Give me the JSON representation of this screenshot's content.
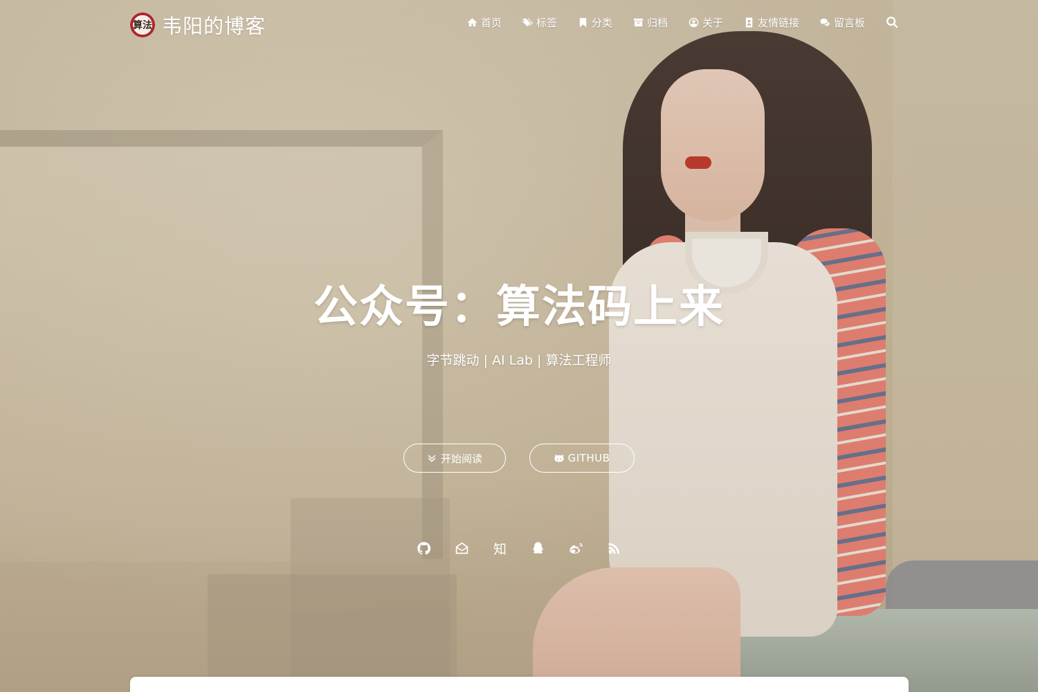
{
  "brand": {
    "logo_text": "算法",
    "title": "韦阳的博客"
  },
  "nav": {
    "items": [
      {
        "label": "首页",
        "icon": "home-icon"
      },
      {
        "label": "标签",
        "icon": "tags-icon"
      },
      {
        "label": "分类",
        "icon": "bookmark-icon"
      },
      {
        "label": "归档",
        "icon": "archive-icon"
      },
      {
        "label": "关于",
        "icon": "user-circle-icon"
      },
      {
        "label": "友情链接",
        "icon": "address-book-icon"
      },
      {
        "label": "留言板",
        "icon": "comments-icon"
      }
    ],
    "search_icon": "search-icon"
  },
  "hero": {
    "title": "公众号：算法码上来",
    "subtitle": "字节跳动 | AI Lab | 算法工程师",
    "buttons": {
      "read_label": "开始阅读",
      "github_label": "GITHUB"
    },
    "social": [
      {
        "name": "github-icon"
      },
      {
        "name": "email-icon"
      },
      {
        "name": "zhihu-icon",
        "text": "知"
      },
      {
        "name": "qq-icon"
      },
      {
        "name": "weibo-icon"
      },
      {
        "name": "rss-icon"
      }
    ]
  },
  "colors": {
    "text": "#ffffff",
    "background": "#c9b99c"
  }
}
